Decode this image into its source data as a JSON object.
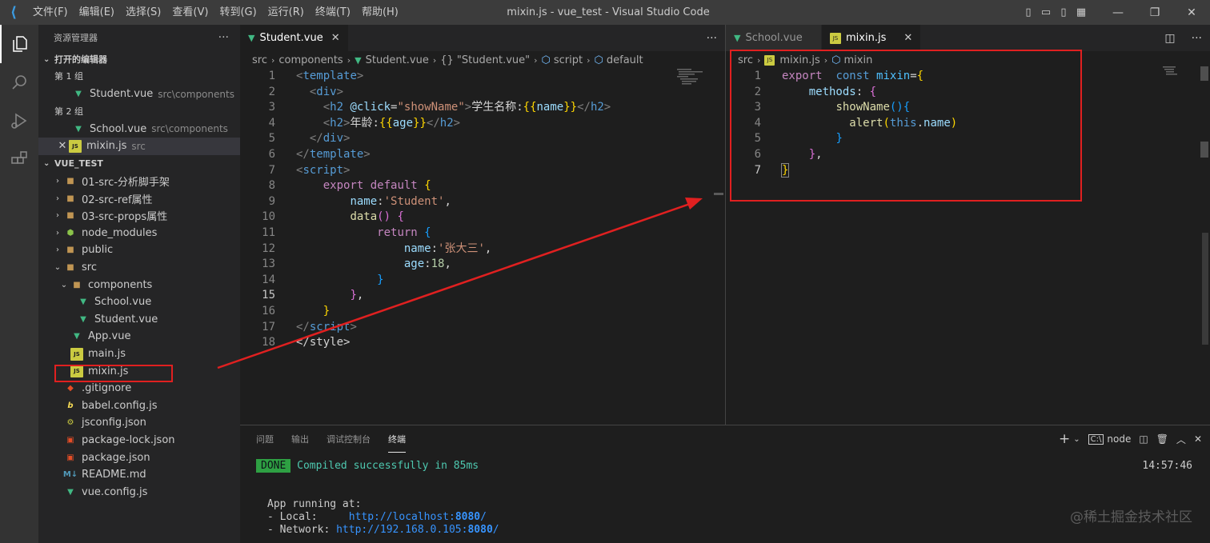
{
  "titlebar": {
    "menus": [
      "文件(F)",
      "编辑(E)",
      "选择(S)",
      "查看(V)",
      "转到(G)",
      "运行(R)",
      "终端(T)",
      "帮助(H)"
    ],
    "window_title": "mixin.js - vue_test - Visual Studio Code"
  },
  "sidebar": {
    "title": "资源管理器",
    "more": "···",
    "open_editors": {
      "header": "打开的编辑器",
      "group1": "第 1 组",
      "group1_item": {
        "name": "Student.vue",
        "path": "src\\components"
      },
      "group2": "第 2 组",
      "group2_items": [
        {
          "name": "School.vue",
          "path": "src\\components"
        },
        {
          "name": "mixin.js",
          "path": "src"
        }
      ]
    },
    "project": {
      "header": "VUE_TEST",
      "items": [
        {
          "label": "01-src-分析脚手架",
          "icon": "folder-icon"
        },
        {
          "label": "02-src-ref属性",
          "icon": "folder-icon"
        },
        {
          "label": "03-src-props属性",
          "icon": "folder-icon"
        },
        {
          "label": "node_modules",
          "icon": "node-icon"
        },
        {
          "label": "public",
          "icon": "folder-icon"
        },
        {
          "label": "src",
          "icon": "folder-icon"
        },
        {
          "label": "components",
          "icon": "folder-icon"
        },
        {
          "label": "School.vue",
          "icon": "vue-icon"
        },
        {
          "label": "Student.vue",
          "icon": "vue-icon"
        },
        {
          "label": "App.vue",
          "icon": "vue-icon"
        },
        {
          "label": "main.js",
          "icon": "js-icon"
        },
        {
          "label": "mixin.js",
          "icon": "js-icon"
        },
        {
          "label": ".gitignore",
          "icon": "git-icon"
        },
        {
          "label": "babel.config.js",
          "icon": "babel-icon"
        },
        {
          "label": "jsconfig.json",
          "icon": "json-icon"
        },
        {
          "label": "package-lock.json",
          "icon": "package-icon"
        },
        {
          "label": "package.json",
          "icon": "package-icon"
        },
        {
          "label": "README.md",
          "icon": "markdown-icon"
        },
        {
          "label": "vue.config.js",
          "icon": "vue-icon"
        }
      ]
    }
  },
  "editor1": {
    "tab": "Student.vue",
    "breadcrumb": [
      "src",
      "components",
      "Student.vue",
      "{} \"Student.vue\"",
      "script",
      "default"
    ],
    "lines": [
      "<template>",
      "  <div>",
      "    <h2 @click=\"showName\">学生名称:{{name}}</h2>",
      "    <h2>年龄:{{age}}</h2>",
      "  </div>",
      "</template>",
      "<script>",
      "    export default {",
      "        name:'Student',",
      "        data() {",
      "            return {",
      "                name:'张大三',",
      "                age:18,",
      "            }",
      "        },",
      "    }",
      "</scr",
      "</style>"
    ]
  },
  "editor2": {
    "tabs": [
      "School.vue",
      "mixin.js"
    ],
    "breadcrumb": [
      "src",
      "mixin.js",
      "mixin"
    ],
    "lines": [
      "export  const mixin={",
      "    methods: {",
      "        showName(){",
      "          alert(this.name)",
      "        }",
      "    },",
      "}"
    ]
  },
  "panel": {
    "tabs": [
      "问题",
      "输出",
      "调试控制台",
      "终端"
    ],
    "shell": "node",
    "time": "14:57:46",
    "done": "DONE",
    "compiled": "Compiled successfully in 85ms",
    "running": "App running at:",
    "local_label": "- Local:   ",
    "local_url": "http://localhost:",
    "local_port": "8080",
    "network_label": "- Network: ",
    "network_url": "http://192.168.0.105:",
    "network_port": "8080",
    "slash": "/"
  },
  "watermark": "@稀土掘金技术社区"
}
